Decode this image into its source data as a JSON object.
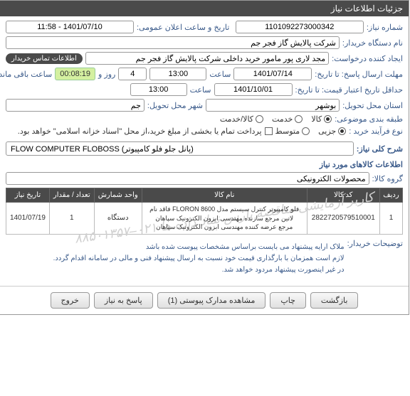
{
  "header": {
    "title": "جزئیات اطلاعات نیاز"
  },
  "fields": {
    "need_no_label": "شماره نیاز:",
    "need_no": "1101092273000342",
    "announce_label": "تاریخ و ساعت اعلان عمومی:",
    "announce_value": "1401/07/10 - 11:58",
    "org_label": "نام دستگاه خریدار:",
    "org_value": "شرکت پالایش گاز فجر جم",
    "requester_label": "ایجاد کننده درخواست:",
    "requester_value": "مجد لاری پور مامور خرید داخلی شرکت پالایش گاز فجر جم",
    "contact_badge": "اطلاعات تماس خریدار",
    "deadline_label": "مهلت ارسال پاسخ: تا تاریخ:",
    "deadline_date": "1401/07/14",
    "time_label": "ساعت",
    "deadline_time": "13:00",
    "days_label": "روز و",
    "days_value": "4",
    "countdown": "00:08:19",
    "remaining_label": "ساعت باقی مانده",
    "min_validity_label": "حداقل تاریخ اعتبار قیمت: تا تاریخ:",
    "min_validity_date": "1401/10/01",
    "min_validity_time": "13:00",
    "delivery_province_label": "استان محل تحویل:",
    "delivery_province": "بوشهر",
    "delivery_city_label": "شهر محل تحویل:",
    "delivery_city": "جم",
    "category_label": "طبقه بندی موضوعی:",
    "cat_goods": "کالا",
    "cat_service": "خدمت",
    "cat_both": "کالا/خدمت",
    "process_label": "نوع فرآیند خرید :",
    "proc_partial": "جزیی",
    "proc_medium": "متوسط",
    "payment_note": "پرداخت تمام یا بخشی از مبلغ خرید،از محل \"اسناد خزانه اسلامی\" خواهد بود.",
    "summary_label": "شرح کلی نیاز:",
    "summary_value": "FLOW COMPUTER FLOBOSS (پانل جلو فلو کامپیوتر)",
    "items_title": "اطلاعات کالاهای مورد نیاز",
    "group_label": "گروه کالا:",
    "group_value": "محصولات الکترونیکی",
    "desc_label": "توضیحات خریدار:",
    "desc_line1": "ملاک ارایه پیشنهاد می بایست براساس مشخصات پیوست شده باشد",
    "desc_line2": "لازم است همزمان با بارگذاری قیمت خود نسبت به ارسال پیشنهاد فنی و مالی در سامانه اقدام گردد.",
    "desc_line3": "در غیر اینصورت پیشنهاد مردود خواهد شد."
  },
  "table": {
    "headers": {
      "row": "ردیف",
      "code": "کد کالا",
      "name": "نام کالا",
      "unit": "واحد شمارش",
      "qty": "تعداد / مقدار",
      "date": "تاریخ نیاز"
    },
    "rows": [
      {
        "idx": "1",
        "code": "2822720579510001",
        "name": "فلو کامپیوتر کنترل سیستم مدل FLORON 8600 فاقد نام\nلاتین مرجع سازنده مهندسی ابزون الکترونیک سپاهان\nمرجع عرضه کننده مهندسی ابزون الکترونیک سپاهان",
        "unit": "دستگاه",
        "qty": "1",
        "date": "1401/07/19"
      }
    ],
    "watermark": "کاربر آزمایشی مناقصه پارس نماد داده ها ۰۲۱–۸۸۵۰۱۳۵۷"
  },
  "buttons": {
    "back": "بازگشت",
    "print": "چاپ",
    "attachments": "مشاهده مدارک پیوستی (1)",
    "reply": "پاسخ به نیاز",
    "close": "خروج"
  }
}
